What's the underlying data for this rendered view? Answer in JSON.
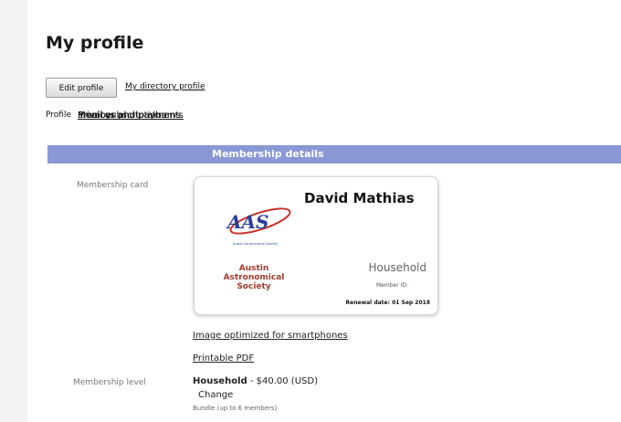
{
  "header": {
    "title": "My profile"
  },
  "toolbar": {
    "edit_label": "Edit profile",
    "directory_label": "My directory profile"
  },
  "tabs": [
    {
      "label": "Profile"
    },
    {
      "label": "Privacy"
    },
    {
      "label": "Email subscriptions"
    },
    {
      "label": "Member photo albums"
    },
    {
      "label": "Invoices and payments"
    }
  ],
  "section": {
    "title": "Membership details"
  },
  "membership_card": {
    "field_label": "Membership card",
    "name": "David Mathias",
    "level": "Household",
    "number_label": "Member ID:",
    "renewal_label": "Renewal date: 01 Sep 2018",
    "org_name_line1": "Austin",
    "org_name_line2": "Astronomical",
    "org_name_line3": "Society",
    "logo_text": "AAS",
    "logo_sub": "Austin Astronomical Society"
  },
  "links": {
    "smartphone": "Image optimized for smartphones",
    "pdf": "Printable PDF"
  },
  "membership_level": {
    "field_label": "Membership level",
    "level_name": "Household",
    "price": " - $40.00 (USD)",
    "change_label": "Change",
    "note": "Bundle (up to 6 members)"
  },
  "colors": {
    "section_bar": "#8a98d6",
    "logo_blue": "#2a3f9a",
    "logo_red": "#c8322a",
    "org_text": "#a23b2c"
  }
}
